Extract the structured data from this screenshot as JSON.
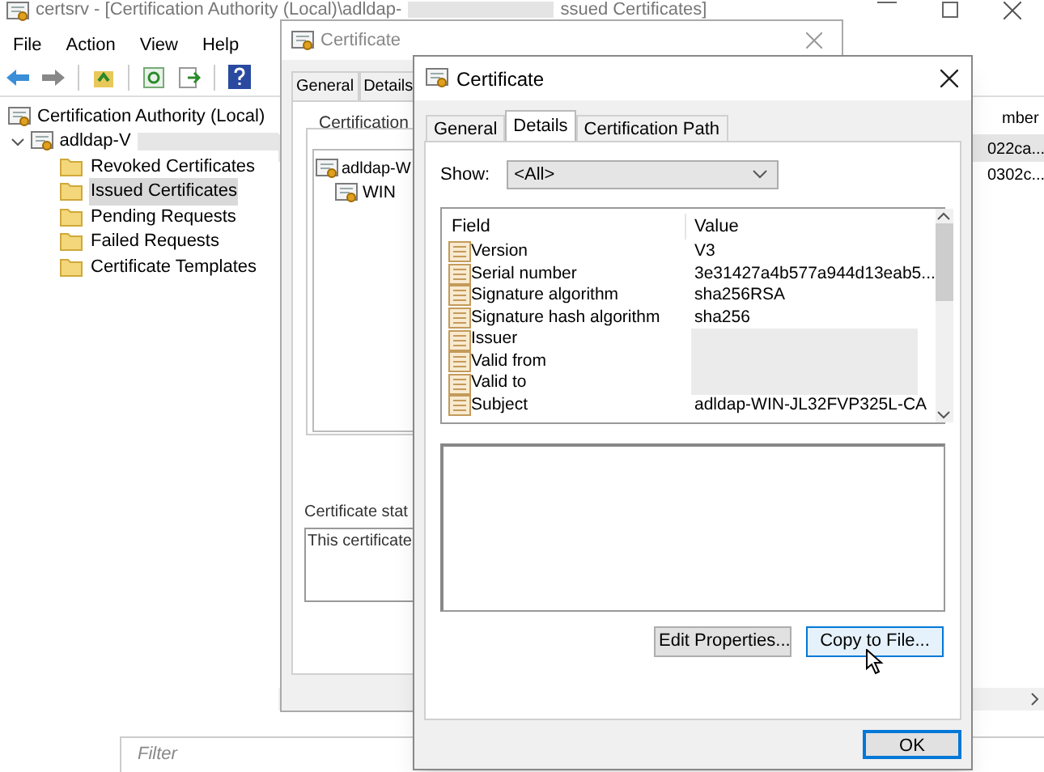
{
  "main_window": {
    "title_start": "certsrv - [Certification Authority (Local)\\adldap-",
    "title_end": "ssued Certificates]",
    "menu": [
      "File",
      "Action",
      "View",
      "Help"
    ],
    "tree": {
      "label": "Certification Authority (Local)",
      "children": [
        {
          "label": "adldap-V",
          "expanded": true,
          "children": [
            {
              "label": "Revoked Certificates",
              "selected": false
            },
            {
              "label": "Issued Certificates",
              "selected": true
            },
            {
              "label": "Pending Requests",
              "selected": false
            },
            {
              "label": "Failed Requests",
              "selected": false
            },
            {
              "label": "Certificate Templates",
              "selected": false
            }
          ]
        }
      ]
    },
    "list": {
      "columns": [
        "mber"
      ],
      "rows": [
        {
          "cells": [
            "022ca..."
          ],
          "selected": true
        },
        {
          "cells": [
            "0302c..."
          ],
          "selected": false
        }
      ]
    },
    "filter": {
      "placeholder": "Filter"
    }
  },
  "back_dialog": {
    "title": "Certificate",
    "tabs": [
      {
        "label": "General",
        "selected": false
      },
      {
        "label": "Details",
        "selected": false
      }
    ],
    "path_group": "Certification",
    "path_tree": [
      {
        "label": "adldap-W",
        "children": [
          {
            "label": "WIN"
          }
        ]
      }
    ],
    "status_label": "Certificate stat",
    "status_text": "This certificate"
  },
  "front_dialog": {
    "title": "Certificate",
    "tabs": [
      {
        "label": "General",
        "selected": false
      },
      {
        "label": "Details",
        "selected": true
      },
      {
        "label": "Certification Path",
        "selected": false
      }
    ],
    "show_label": "Show:",
    "show_value": "<All>",
    "fields": {
      "columns": [
        "Field",
        "Value"
      ],
      "rows": [
        {
          "field": "Version",
          "value": "V3"
        },
        {
          "field": "Serial number",
          "value": "3e31427a4b577a944d13eab5..."
        },
        {
          "field": "Signature algorithm",
          "value": "sha256RSA"
        },
        {
          "field": "Signature hash algorithm",
          "value": "sha256"
        },
        {
          "field": "Issuer"
        },
        {
          "field": "Valid from"
        },
        {
          "field": "Valid to"
        },
        {
          "field": "Subject",
          "value": "adldap-WIN-JL32FVP325L-CA"
        }
      ]
    },
    "buttons": [
      {
        "label": "Edit Properties...",
        "focused": false
      },
      {
        "label": "Copy to File...",
        "focused": true
      }
    ],
    "ok": {
      "label": "OK",
      "focused": true
    }
  }
}
